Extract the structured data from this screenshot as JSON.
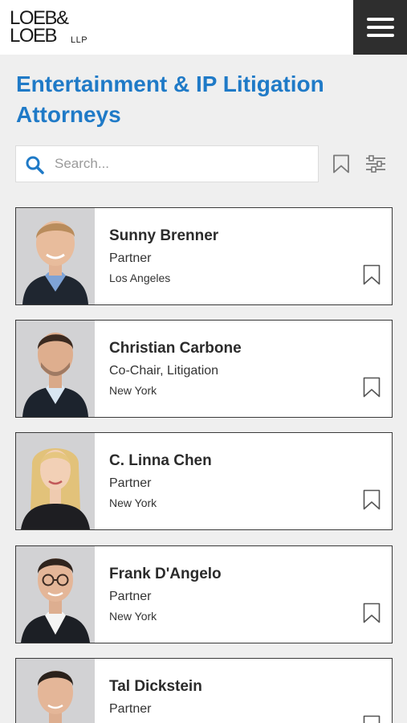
{
  "brand": {
    "line1": "LOEB&",
    "line2": "LOEB",
    "suffix": "LLP"
  },
  "header": {
    "menu_icon": "hamburger-menu-icon"
  },
  "page": {
    "title": "Entertainment & IP Litigation Attorneys"
  },
  "search": {
    "placeholder": "Search...",
    "value": "",
    "icon": "search-icon"
  },
  "toolbar": {
    "bookmark_icon": "bookmark-icon",
    "filter_icon": "sliders-icon"
  },
  "colors": {
    "accent": "#1f7ac7",
    "header_dark": "#2e2e2e",
    "page_bg": "#efefef"
  },
  "attorneys": [
    {
      "name": "Sunny Brenner",
      "role": "Partner",
      "office": "Los Angeles"
    },
    {
      "name": "Christian Carbone",
      "role": "Co-Chair, Litigation",
      "office": "New York"
    },
    {
      "name": "C. Linna Chen",
      "role": "Partner",
      "office": "New York"
    },
    {
      "name": "Frank D'Angelo",
      "role": "Partner",
      "office": "New York"
    },
    {
      "name": "Tal Dickstein",
      "role": "Partner",
      "office": ""
    }
  ]
}
